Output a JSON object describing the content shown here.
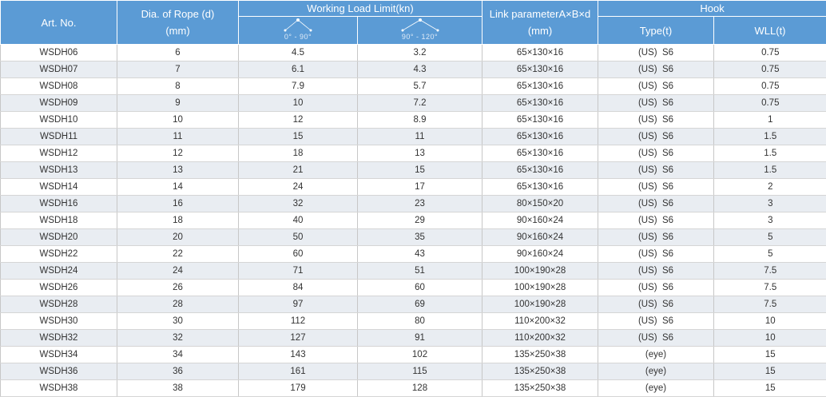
{
  "headers": {
    "art_no": "Art. No.",
    "dia_line1": "Dia. of Rope (d)",
    "dia_line2": "(mm)",
    "wll_group": "Working Load Limit(kn)",
    "wll_angle1": "0° - 90°",
    "wll_angle2": "90° - 120°",
    "link_line1": "Link parameterA×B×d",
    "link_line2": "(mm)",
    "hook_group": "Hook",
    "hook_type": "Type(t)",
    "hook_wll": "WLL(t)"
  },
  "rows": [
    [
      "WSDH06",
      "6",
      "4.5",
      "3.2",
      "65×130×16",
      "(US)  S6",
      "0.75"
    ],
    [
      "WSDH07",
      "7",
      "6.1",
      "4.3",
      "65×130×16",
      "(US)  S6",
      "0.75"
    ],
    [
      "WSDH08",
      "8",
      "7.9",
      "5.7",
      "65×130×16",
      "(US)  S6",
      "0.75"
    ],
    [
      "WSDH09",
      "9",
      "10",
      "7.2",
      "65×130×16",
      "(US)  S6",
      "0.75"
    ],
    [
      "WSDH10",
      "10",
      "12",
      "8.9",
      "65×130×16",
      "(US)  S6",
      "1"
    ],
    [
      "WSDH11",
      "11",
      "15",
      "11",
      "65×130×16",
      "(US)  S6",
      "1.5"
    ],
    [
      "WSDH12",
      "12",
      "18",
      "13",
      "65×130×16",
      "(US)  S6",
      "1.5"
    ],
    [
      "WSDH13",
      "13",
      "21",
      "15",
      "65×130×16",
      "(US)  S6",
      "1.5"
    ],
    [
      "WSDH14",
      "14",
      "24",
      "17",
      "65×130×16",
      "(US)  S6",
      "2"
    ],
    [
      "WSDH16",
      "16",
      "32",
      "23",
      "80×150×20",
      "(US)  S6",
      "3"
    ],
    [
      "WSDH18",
      "18",
      "40",
      "29",
      "90×160×24",
      "(US)  S6",
      "3"
    ],
    [
      "WSDH20",
      "20",
      "50",
      "35",
      "90×160×24",
      "(US)  S6",
      "5"
    ],
    [
      "WSDH22",
      "22",
      "60",
      "43",
      "90×160×24",
      "(US)  S6",
      "5"
    ],
    [
      "WSDH24",
      "24",
      "71",
      "51",
      "100×190×28",
      "(US)  S6",
      "7.5"
    ],
    [
      "WSDH26",
      "26",
      "84",
      "60",
      "100×190×28",
      "(US)  S6",
      "7.5"
    ],
    [
      "WSDH28",
      "28",
      "97",
      "69",
      "100×190×28",
      "(US)  S6",
      "7.5"
    ],
    [
      "WSDH30",
      "30",
      "112",
      "80",
      "110×200×32",
      "(US)  S6",
      "10"
    ],
    [
      "WSDH32",
      "32",
      "127",
      "91",
      "110×200×32",
      "(US)  S6",
      "10"
    ],
    [
      "WSDH34",
      "34",
      "143",
      "102",
      "135×250×38",
      "(eye)",
      "15"
    ],
    [
      "WSDH36",
      "36",
      "161",
      "115",
      "135×250×38",
      "(eye)",
      "15"
    ],
    [
      "WSDH38",
      "38",
      "179",
      "128",
      "135×250×38",
      "(eye)",
      "15"
    ]
  ],
  "colors": {
    "header_bg": "#5b9bd5",
    "row_alt": "#e9edf2"
  }
}
